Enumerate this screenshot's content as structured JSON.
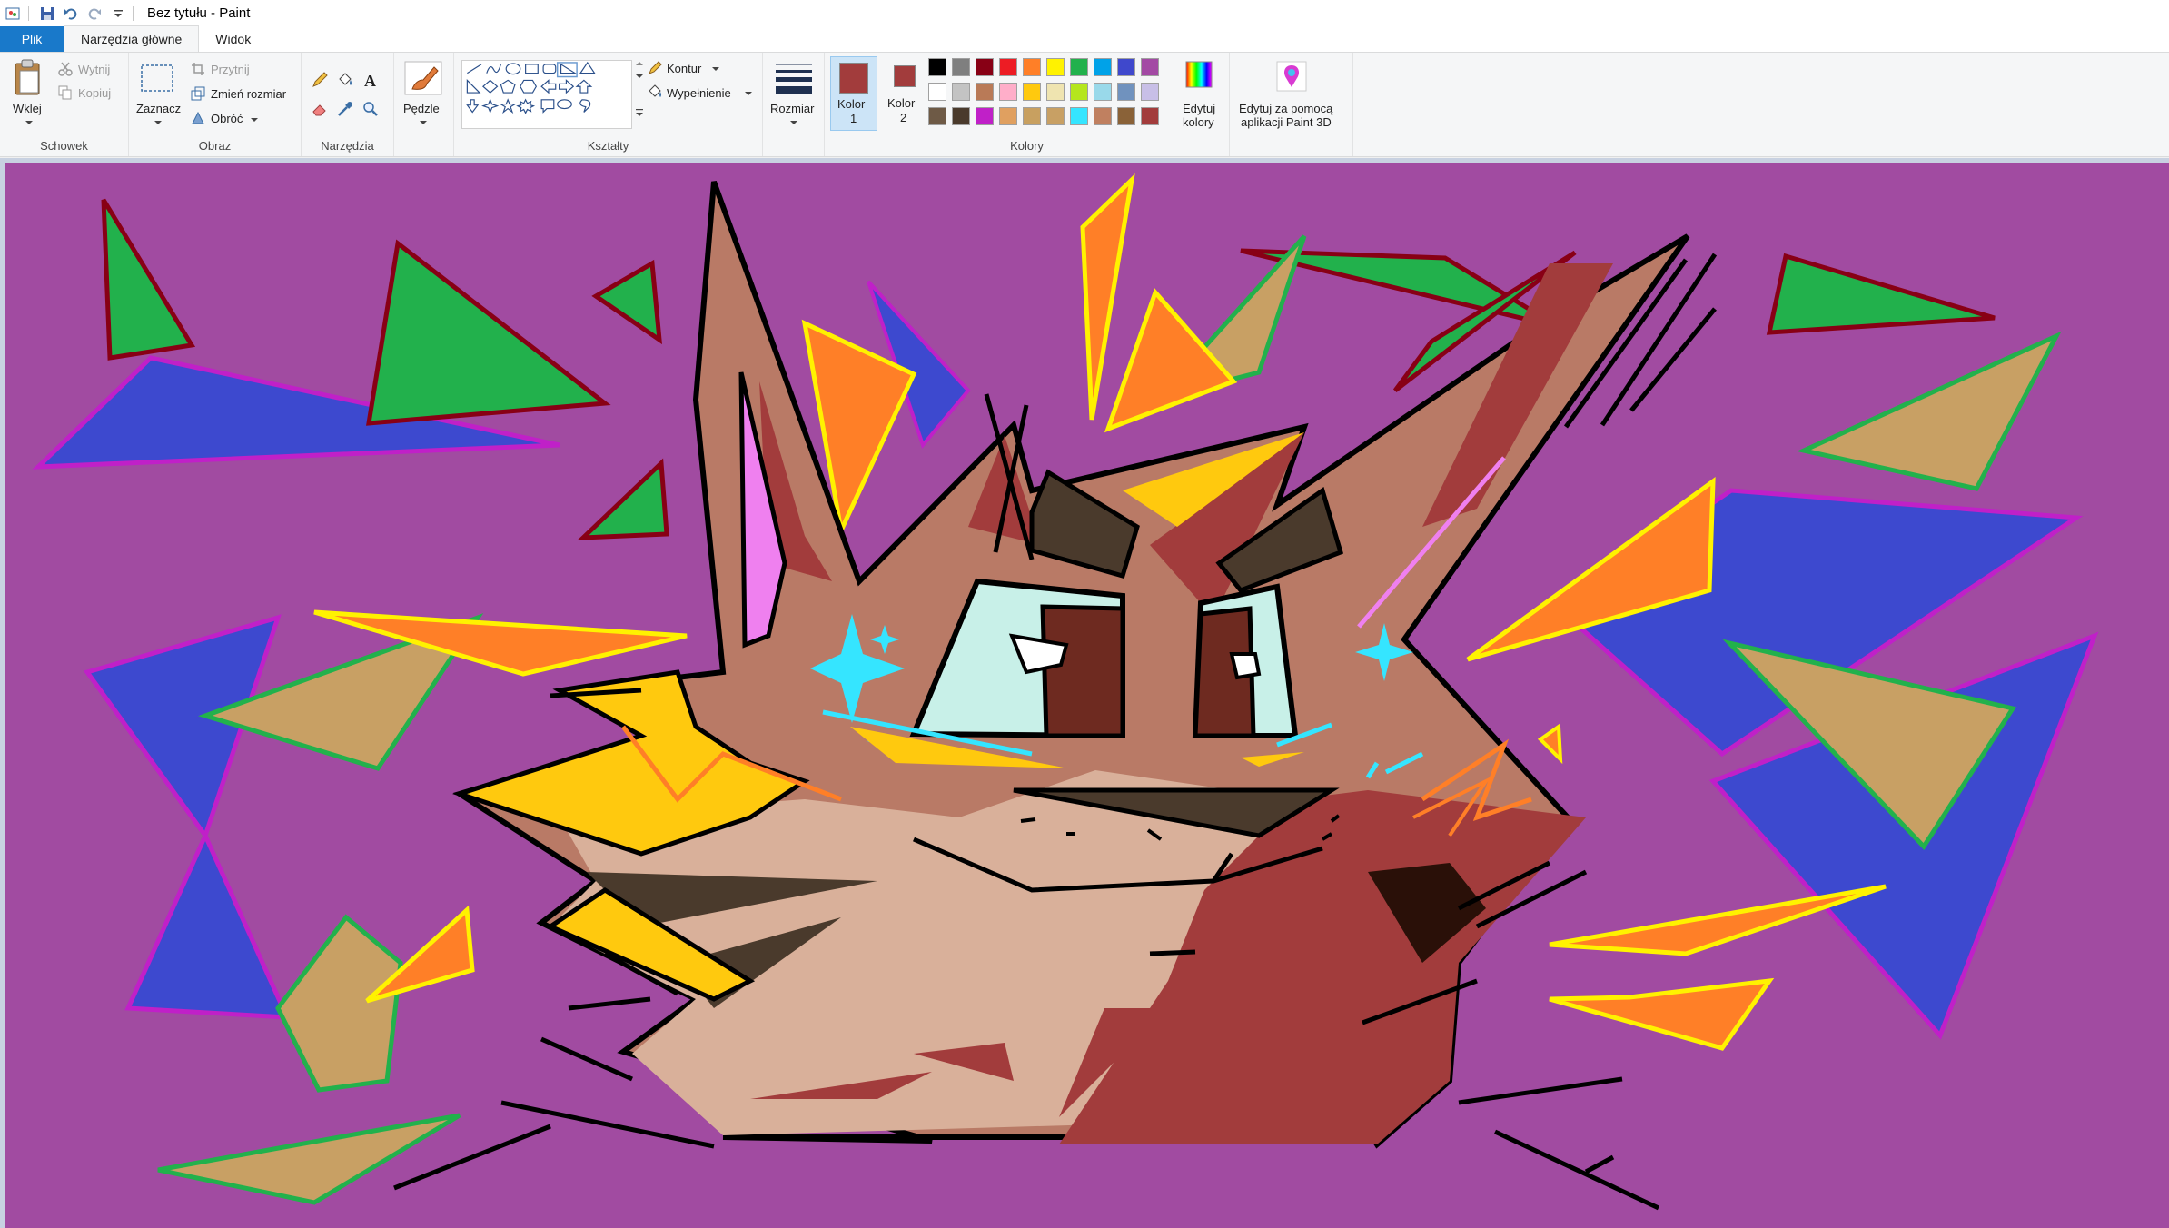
{
  "window": {
    "title": "Bez tytułu - Paint"
  },
  "tabs": [
    {
      "label": "Plik"
    },
    {
      "label": "Narzędzia główne"
    },
    {
      "label": "Widok"
    }
  ],
  "ribbon": {
    "clipboard": {
      "paste": "Wklej",
      "cut": "Wytnij",
      "copy": "Kopiuj",
      "group": "Schowek"
    },
    "image": {
      "select": "Zaznacz",
      "crop": "Przytnij",
      "resize": "Zmień rozmiar",
      "rotate": "Obróć",
      "group": "Obraz"
    },
    "tools": {
      "group": "Narzędzia"
    },
    "brushes": {
      "label": "Pędzle"
    },
    "shapes": {
      "outline": "Kontur",
      "fill": "Wypełnienie",
      "group": "Kształty"
    },
    "size": {
      "label": "Rozmiar"
    },
    "colors": {
      "color1": "Kolor",
      "color1_num": "1",
      "color2": "Kolor",
      "color2_num": "2",
      "edit_colors_1": "Edytuj",
      "edit_colors_2": "kolory",
      "group": "Kolory",
      "color1_value": "#a23c3c",
      "color2_value": "#a23c3c",
      "palette": [
        [
          "#000000",
          "#7f7f7f",
          "#880015",
          "#ed1c24",
          "#ff7f27",
          "#fff200",
          "#22b14c",
          "#00a2e8",
          "#3f48cc",
          "#a349a4"
        ],
        [
          "#ffffff",
          "#c3c3c3",
          "#b97a57",
          "#ffaec9",
          "#ffc90e",
          "#efe4b0",
          "#b5e61d",
          "#99d9ea",
          "#7092be",
          "#c8bfe7"
        ],
        [
          "#6e5a46",
          "#4a3a2c",
          "#c020c8",
          "#e0a060",
          "#c8a060",
          "#c8a064",
          "#35e5ff",
          "#c08060",
          "#8a6238",
          "#a23c3c",
          "#2a1a10"
        ]
      ]
    },
    "paint3d": {
      "line1": "Edytuj za pomocą",
      "line2": "aplikacji Paint 3D"
    }
  },
  "canvas": {
    "background": "#a14ba1"
  }
}
